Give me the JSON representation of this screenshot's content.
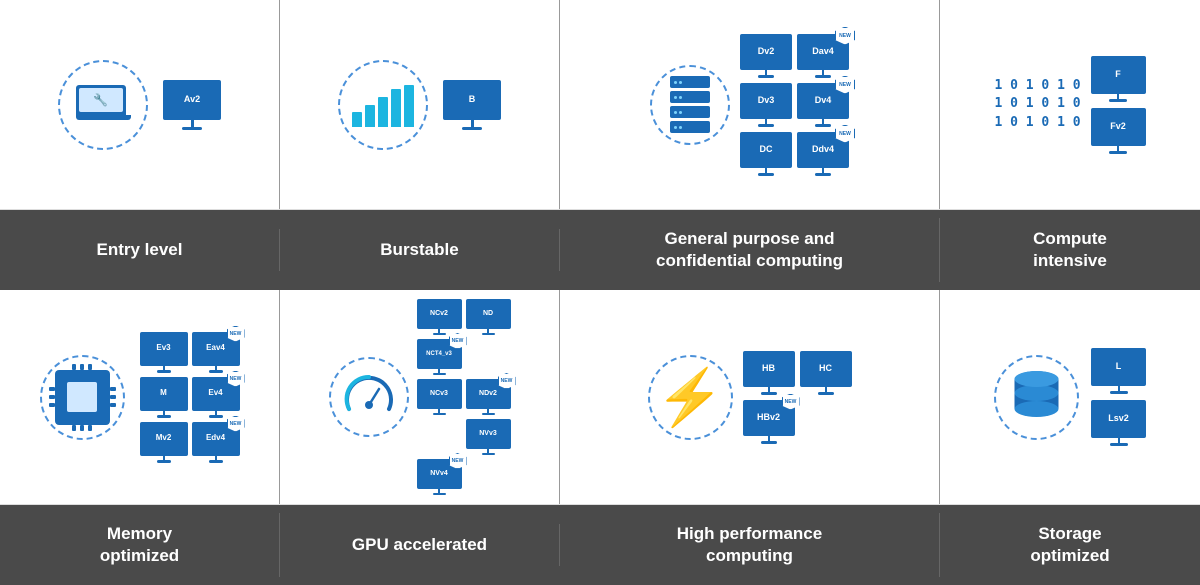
{
  "colors": {
    "bg_white": "#ffffff",
    "bg_dark": "#4a4a4a",
    "blue_primary": "#1a6ab5",
    "blue_light": "#1cb5e0",
    "blue_monitor": "#2a8ad4"
  },
  "top_labels": {
    "entry": "Entry level",
    "burstable": "Burstable",
    "general": "General purpose and\nconfidential computing",
    "compute": "Compute\nintensive"
  },
  "bottom_labels": {
    "memory": "Memory\noptimized",
    "gpu": "GPU accelerated",
    "hpc": "High performance\ncomputing",
    "storage": "Storage\noptimized"
  },
  "vm_series": {
    "av2": "Av2",
    "b": "B",
    "dv2": "Dv2",
    "dav4": "Dav4",
    "dv3": "Dv3",
    "dv4": "Dv4",
    "dc": "DC",
    "ddv4": "Ddv4",
    "f": "F",
    "fv2": "Fv2",
    "ev3": "Ev3",
    "eav4": "Eav4",
    "m": "M",
    "ev4": "Ev4",
    "mv2": "Mv2",
    "edv4": "Edv4",
    "ncv2": "NCv2",
    "nd": "ND",
    "nct4_v3": "NCT4_v3",
    "ncv3": "NCv3",
    "ndv2": "NDv2",
    "nvv3": "NVv3",
    "nvv4": "NVv4",
    "hb": "HB",
    "hc": "HC",
    "hbv2": "HBv2",
    "l": "L",
    "lsv2": "Lsv2"
  },
  "new_badge": "NEW"
}
